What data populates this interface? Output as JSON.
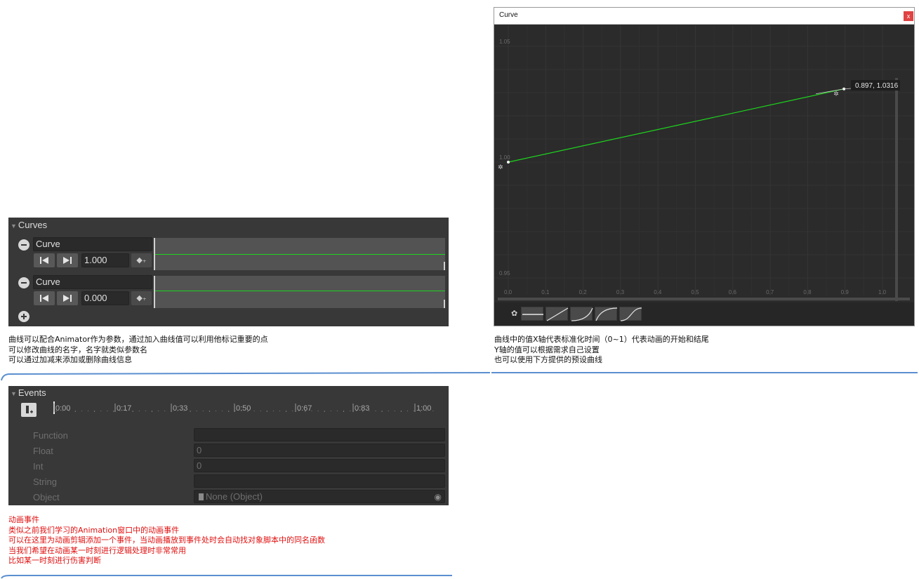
{
  "curves_panel": {
    "title": "Curves",
    "curves": [
      {
        "name": "Curve",
        "value": "1.000",
        "line_level": 0.5
      },
      {
        "name": "Curve",
        "value": "0.000",
        "line_level": 0.45
      }
    ],
    "key_label": "◆₊"
  },
  "curves_notes": [
    "曲线可以配合Animator作为参数，通过加入曲线值可以利用他标记重要的点",
    "可以修改曲线的名字，名字就类似参数名",
    "可以通过加减来添加或删除曲线信息"
  ],
  "curve_window": {
    "title": "Curve",
    "close_label": "x",
    "key_readout": "0.897, 1.0316",
    "y_labels": [
      "1.05",
      "1.00",
      "0.95"
    ],
    "x_labels": [
      "0.0",
      "0.1",
      "0.2",
      "0.3",
      "0.4",
      "0.5",
      "0.6",
      "0.7",
      "0.8",
      "0.9",
      "1.0"
    ]
  },
  "chart_data": {
    "type": "line",
    "x": [
      0.0,
      0.897
    ],
    "y": [
      1.0,
      1.0316
    ],
    "xlim": [
      0.0,
      1.0
    ],
    "ylim": [
      0.95,
      1.05
    ],
    "grid": true,
    "line_color": "#1ed51e"
  },
  "window_notes": [
    "曲线中的值X轴代表标准化时间（0~1）代表动画的开始和结尾",
    "Y轴的值可以根据需求自己设置",
    "也可以使用下方提供的预设曲线"
  ],
  "events_panel": {
    "title": "Events",
    "timeline_labels": [
      "0:00",
      "0:17",
      "0:33",
      "0:50",
      "0:67",
      "0:83",
      "1:00"
    ],
    "properties": [
      {
        "label": "Function",
        "value": ""
      },
      {
        "label": "Float",
        "value": "0"
      },
      {
        "label": "Int",
        "value": "0"
      },
      {
        "label": "String",
        "value": ""
      },
      {
        "label": "Object",
        "value": "None (Object)"
      }
    ]
  },
  "events_notes": [
    "动画事件",
    "类似之前我们学习的Animation窗口中的动画事件",
    "可以在这里为动画剪辑添加一个事件，当动画播放到事件处时会自动找对象脚本中的同名函数",
    "当我们希望在动画某一时刻进行逻辑处理时非常常用",
    "比如某一时刻进行伤害判断"
  ],
  "colors": {
    "panel_bg": "#383838",
    "curve_green": "#1ed51e",
    "note_red": "#e01010",
    "separator_blue": "#5b8fd0"
  }
}
